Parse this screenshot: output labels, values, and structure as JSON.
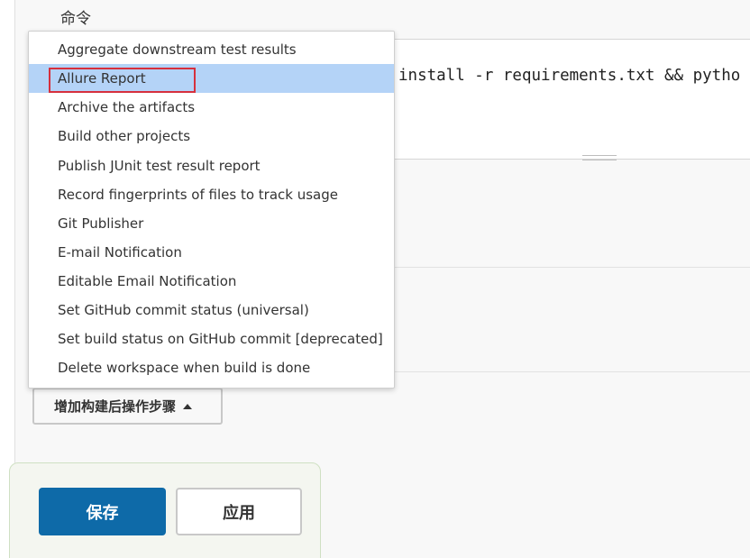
{
  "command_section": {
    "label": "命令",
    "command_text_visible": "install -r requirements.txt && pytho"
  },
  "post_build_menu": {
    "items": [
      {
        "label": "Aggregate downstream test results"
      },
      {
        "label": "Allure Report",
        "hovered": true,
        "highlighted": true
      },
      {
        "label": "Archive the artifacts"
      },
      {
        "label": "Build other projects"
      },
      {
        "label": "Publish JUnit test result report"
      },
      {
        "label": "Record fingerprints of files to track usage"
      },
      {
        "label": "Git Publisher"
      },
      {
        "label": "E-mail Notification"
      },
      {
        "label": "Editable Email Notification"
      },
      {
        "label": "Set GitHub commit status (universal)"
      },
      {
        "label": "Set build status on GitHub commit [deprecated]"
      },
      {
        "label": "Delete workspace when build is done"
      }
    ]
  },
  "add_post_build_step_button": {
    "label": "增加构建后操作步骤",
    "icon": "caret-up-icon"
  },
  "actions": {
    "save_label": "保存",
    "apply_label": "应用"
  },
  "colors": {
    "save_button": "#0e6aa8",
    "menu_hover": "#b4d3f7",
    "highlight_border": "#d6303d"
  }
}
